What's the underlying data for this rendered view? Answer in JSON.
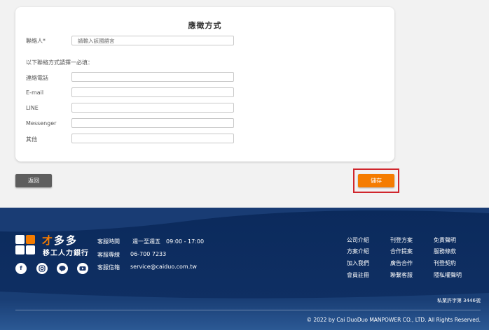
{
  "form": {
    "title": "應徵方式",
    "contact_label": "聯絡人*",
    "contact_placeholder": "請輸入該國語言",
    "note": "以下聯絡方式請擇一必填：",
    "fields": [
      {
        "label": "連絡電話",
        "value": ""
      },
      {
        "label": "E-mail",
        "value": ""
      },
      {
        "label": "LINE",
        "value": ""
      },
      {
        "label": "Messenger",
        "value": ""
      },
      {
        "label": "其他",
        "value": ""
      }
    ]
  },
  "actions": {
    "back_label": "返回",
    "save_label": "儲存",
    "save_color": "#f57c00",
    "highlight_color": "#d0262d"
  },
  "footer": {
    "brand_main_accent": "才",
    "brand_main_rest": "多多",
    "brand_sub": "移工人力銀行",
    "social_icons": [
      "facebook-icon",
      "instagram-icon",
      "line-icon",
      "youtube-icon"
    ],
    "service_hours_label": "客服時間",
    "service_hours_value": "週一至週五　09:00 - 17:00",
    "hotline_label": "客服專線",
    "hotline_value": "06-700 7233",
    "email_label": "客服信箱",
    "email_value": "service@caiduo.com.tw",
    "links": {
      "col1": [
        "公司介紹",
        "方案介紹",
        "加入我們",
        "會員註冊"
      ],
      "col2": [
        "刊登方案",
        "合作提案",
        "廣告合作",
        "聯繫客服"
      ],
      "col3": [
        "免責聲明",
        "服務條款",
        "刊登契約",
        "隱私權聲明"
      ]
    },
    "license": "私業許字第 3446號",
    "copyright": "© 2022 by Cai DuoDuo MANPOWER CO., LTD. All Rights Reserved.",
    "bg_color": "#0e2c5e"
  }
}
